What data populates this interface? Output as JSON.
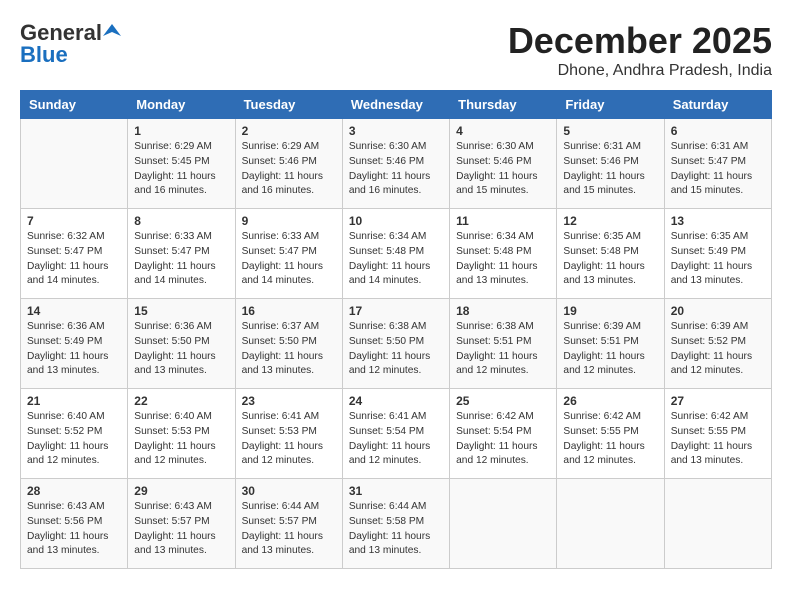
{
  "logo": {
    "line1": "General",
    "line2": "Blue"
  },
  "title": "December 2025",
  "location": "Dhone, Andhra Pradesh, India",
  "headers": [
    "Sunday",
    "Monday",
    "Tuesday",
    "Wednesday",
    "Thursday",
    "Friday",
    "Saturday"
  ],
  "weeks": [
    [
      {
        "day": "",
        "info": ""
      },
      {
        "day": "1",
        "info": "Sunrise: 6:29 AM\nSunset: 5:45 PM\nDaylight: 11 hours\nand 16 minutes."
      },
      {
        "day": "2",
        "info": "Sunrise: 6:29 AM\nSunset: 5:46 PM\nDaylight: 11 hours\nand 16 minutes."
      },
      {
        "day": "3",
        "info": "Sunrise: 6:30 AM\nSunset: 5:46 PM\nDaylight: 11 hours\nand 16 minutes."
      },
      {
        "day": "4",
        "info": "Sunrise: 6:30 AM\nSunset: 5:46 PM\nDaylight: 11 hours\nand 15 minutes."
      },
      {
        "day": "5",
        "info": "Sunrise: 6:31 AM\nSunset: 5:46 PM\nDaylight: 11 hours\nand 15 minutes."
      },
      {
        "day": "6",
        "info": "Sunrise: 6:31 AM\nSunset: 5:47 PM\nDaylight: 11 hours\nand 15 minutes."
      }
    ],
    [
      {
        "day": "7",
        "info": "Sunrise: 6:32 AM\nSunset: 5:47 PM\nDaylight: 11 hours\nand 14 minutes."
      },
      {
        "day": "8",
        "info": "Sunrise: 6:33 AM\nSunset: 5:47 PM\nDaylight: 11 hours\nand 14 minutes."
      },
      {
        "day": "9",
        "info": "Sunrise: 6:33 AM\nSunset: 5:47 PM\nDaylight: 11 hours\nand 14 minutes."
      },
      {
        "day": "10",
        "info": "Sunrise: 6:34 AM\nSunset: 5:48 PM\nDaylight: 11 hours\nand 14 minutes."
      },
      {
        "day": "11",
        "info": "Sunrise: 6:34 AM\nSunset: 5:48 PM\nDaylight: 11 hours\nand 13 minutes."
      },
      {
        "day": "12",
        "info": "Sunrise: 6:35 AM\nSunset: 5:48 PM\nDaylight: 11 hours\nand 13 minutes."
      },
      {
        "day": "13",
        "info": "Sunrise: 6:35 AM\nSunset: 5:49 PM\nDaylight: 11 hours\nand 13 minutes."
      }
    ],
    [
      {
        "day": "14",
        "info": "Sunrise: 6:36 AM\nSunset: 5:49 PM\nDaylight: 11 hours\nand 13 minutes."
      },
      {
        "day": "15",
        "info": "Sunrise: 6:36 AM\nSunset: 5:50 PM\nDaylight: 11 hours\nand 13 minutes."
      },
      {
        "day": "16",
        "info": "Sunrise: 6:37 AM\nSunset: 5:50 PM\nDaylight: 11 hours\nand 13 minutes."
      },
      {
        "day": "17",
        "info": "Sunrise: 6:38 AM\nSunset: 5:50 PM\nDaylight: 11 hours\nand 12 minutes."
      },
      {
        "day": "18",
        "info": "Sunrise: 6:38 AM\nSunset: 5:51 PM\nDaylight: 11 hours\nand 12 minutes."
      },
      {
        "day": "19",
        "info": "Sunrise: 6:39 AM\nSunset: 5:51 PM\nDaylight: 11 hours\nand 12 minutes."
      },
      {
        "day": "20",
        "info": "Sunrise: 6:39 AM\nSunset: 5:52 PM\nDaylight: 11 hours\nand 12 minutes."
      }
    ],
    [
      {
        "day": "21",
        "info": "Sunrise: 6:40 AM\nSunset: 5:52 PM\nDaylight: 11 hours\nand 12 minutes."
      },
      {
        "day": "22",
        "info": "Sunrise: 6:40 AM\nSunset: 5:53 PM\nDaylight: 11 hours\nand 12 minutes."
      },
      {
        "day": "23",
        "info": "Sunrise: 6:41 AM\nSunset: 5:53 PM\nDaylight: 11 hours\nand 12 minutes."
      },
      {
        "day": "24",
        "info": "Sunrise: 6:41 AM\nSunset: 5:54 PM\nDaylight: 11 hours\nand 12 minutes."
      },
      {
        "day": "25",
        "info": "Sunrise: 6:42 AM\nSunset: 5:54 PM\nDaylight: 11 hours\nand 12 minutes."
      },
      {
        "day": "26",
        "info": "Sunrise: 6:42 AM\nSunset: 5:55 PM\nDaylight: 11 hours\nand 12 minutes."
      },
      {
        "day": "27",
        "info": "Sunrise: 6:42 AM\nSunset: 5:55 PM\nDaylight: 11 hours\nand 13 minutes."
      }
    ],
    [
      {
        "day": "28",
        "info": "Sunrise: 6:43 AM\nSunset: 5:56 PM\nDaylight: 11 hours\nand 13 minutes."
      },
      {
        "day": "29",
        "info": "Sunrise: 6:43 AM\nSunset: 5:57 PM\nDaylight: 11 hours\nand 13 minutes."
      },
      {
        "day": "30",
        "info": "Sunrise: 6:44 AM\nSunset: 5:57 PM\nDaylight: 11 hours\nand 13 minutes."
      },
      {
        "day": "31",
        "info": "Sunrise: 6:44 AM\nSunset: 5:58 PM\nDaylight: 11 hours\nand 13 minutes."
      },
      {
        "day": "",
        "info": ""
      },
      {
        "day": "",
        "info": ""
      },
      {
        "day": "",
        "info": ""
      }
    ]
  ]
}
